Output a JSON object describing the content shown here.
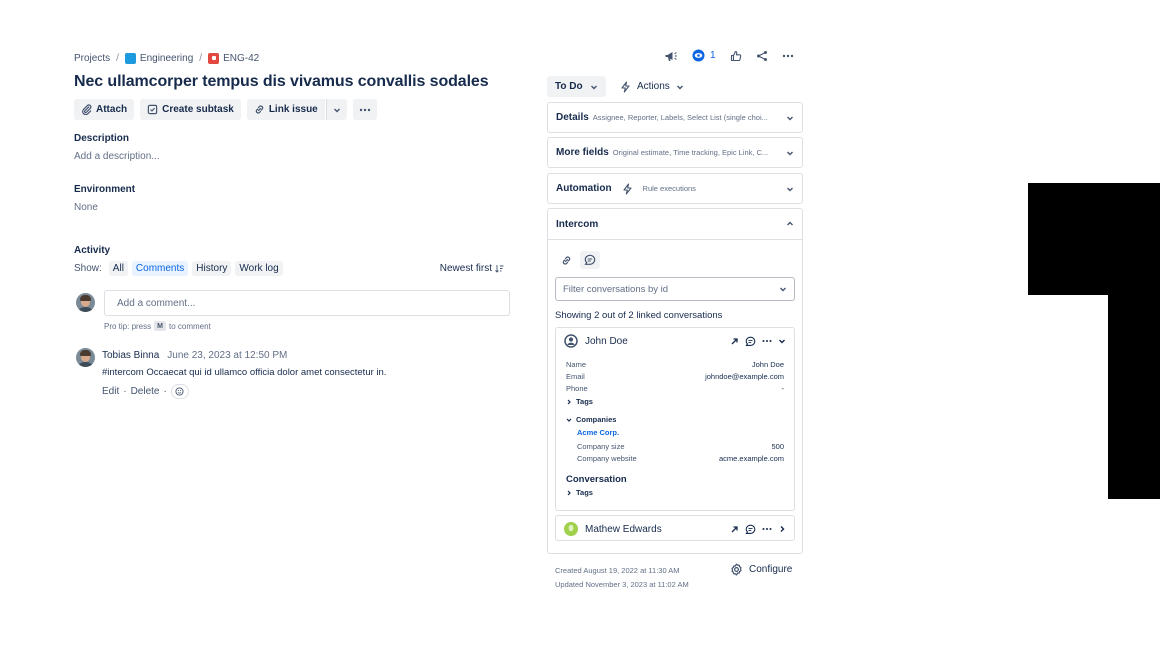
{
  "breadcrumb": {
    "root": "Projects",
    "project": "Engineering",
    "issue": "ENG-42"
  },
  "issue": {
    "title": "Nec ullamcorper tempus dis vivamus convallis sodales"
  },
  "toolbar": {
    "attach": "Attach",
    "create_subtask": "Create subtask",
    "link_issue": "Link issue"
  },
  "description": {
    "heading": "Description",
    "placeholder": "Add a description..."
  },
  "environment": {
    "heading": "Environment",
    "value": "None"
  },
  "activity": {
    "heading": "Activity",
    "show_label": "Show:",
    "filters": [
      "All",
      "Comments",
      "History",
      "Work log"
    ],
    "sort": "Newest first",
    "comment_placeholder": "Add a comment...",
    "protip_prefix": "Pro tip: press",
    "protip_key": "M",
    "protip_suffix": "to comment",
    "comment": {
      "author": "Tobias Binna",
      "date": "June 23, 2023 at 12:50 PM",
      "body": "#intercom Occaecat qui id ullamco officia dolor amet consectetur in.",
      "edit": "Edit",
      "delete": "Delete",
      "separator": "·"
    }
  },
  "header": {
    "watch_count": "1"
  },
  "status": {
    "label": "To Do"
  },
  "actions": {
    "label": "Actions"
  },
  "panels": {
    "details": {
      "title": "Details",
      "summary": "Assignee, Reporter, Labels, Select List (single choi..."
    },
    "more_fields": {
      "title": "More fields",
      "summary": "Original estimate, Time tracking, Epic Link, C..."
    },
    "automation": {
      "title": "Automation",
      "summary": "Rule executions"
    }
  },
  "intercom": {
    "title": "Intercom",
    "filter_placeholder": "Filter conversations by id",
    "count_text": "Showing 2 out of 2 linked conversations",
    "conversations": [
      {
        "name": "John Doe",
        "fields": [
          {
            "key": "Name",
            "value": "John Doe"
          },
          {
            "key": "Email",
            "value": "johndoe@example.com"
          },
          {
            "key": "Phone",
            "value": "-"
          }
        ],
        "tags_label": "Tags",
        "companies_label": "Companies",
        "company": {
          "name": "Acme Corp.",
          "size_label": "Company size",
          "size_value": "500",
          "website_label": "Company website",
          "website_value": "acme.example.com"
        },
        "conversation_label": "Conversation",
        "conversation_tags_label": "Tags"
      },
      {
        "name": "Mathew Edwards"
      }
    ]
  },
  "footer": {
    "created": "Created August 19, 2022 at 11:30 AM",
    "updated": "Updated November 3, 2023 at 11:02 AM",
    "configure": "Configure"
  },
  "overlay": {
    "numeral": "1"
  },
  "colors": {
    "accent": "#0c66e4",
    "text": "#172b4d",
    "subtle": "#626f86",
    "border": "#dcdfe4"
  },
  "icons": [
    "megaphone-icon",
    "eye-icon",
    "thumbs-up-icon",
    "share-icon",
    "more-icon",
    "paperclip-icon",
    "subtask-icon",
    "link-icon",
    "lightning-icon",
    "chat-icon",
    "user-icon",
    "external-link-icon",
    "gear-icon"
  ]
}
